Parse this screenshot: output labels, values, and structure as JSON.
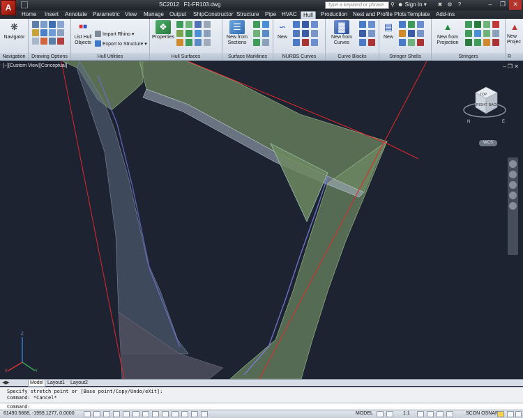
{
  "titlebar": {
    "app_name": "SC2012",
    "file_name": "F1-FR103.dwg",
    "search_placeholder": "Type a keyword or phrase",
    "sign_in": "Sign In"
  },
  "tabs": [
    {
      "label": "Home"
    },
    {
      "label": "Insert"
    },
    {
      "label": "Annotate"
    },
    {
      "label": "Parametric"
    },
    {
      "label": "View"
    },
    {
      "label": "Manage"
    },
    {
      "label": "Output"
    },
    {
      "label": "ShipConstructor"
    },
    {
      "label": "Structure"
    },
    {
      "label": "Pipe"
    },
    {
      "label": "HVAC"
    },
    {
      "label": "Hull"
    },
    {
      "label": "Production"
    },
    {
      "label": "Nest and Profile Plots"
    },
    {
      "label": "Template"
    },
    {
      "label": "Add-ins"
    }
  ],
  "active_tab": "Hull",
  "ribbon": {
    "navigation": {
      "title": "Navigation",
      "navigator": "Navigator"
    },
    "drawing_options": {
      "title": "Drawing Options"
    },
    "hull_utilities": {
      "title": "Hull Utilities",
      "list_hull_objects_1": "List Hull",
      "list_hull_objects_2": "Objects",
      "import_rhino": "Import Rhino",
      "export_to_structure": "Export to Structure"
    },
    "hull_surfaces": {
      "title": "Hull Surfaces",
      "properties": "Properties"
    },
    "surface_marklines": {
      "title": "Surface Marklines",
      "new_from_sections_1": "New from",
      "new_from_sections_2": "Sections"
    },
    "nurbs_curves": {
      "title": "NURBS Curves",
      "new": "New"
    },
    "curve_blocks": {
      "title": "Curve Blocks",
      "new_from_curves_1": "New from",
      "new_from_curves_2": "Curves"
    },
    "stringer_shells": {
      "title": "Stringer Shells",
      "new": "New"
    },
    "stringers": {
      "title": "Stringers",
      "new_from_projection_1": "New from",
      "new_from_projection_2": "Projection"
    },
    "overflow": {
      "title": "R",
      "label_1": "New",
      "label_2": "Projec"
    }
  },
  "viewport": {
    "view_label": "[−][Custom View][Conceptual]",
    "wcs": "WCS",
    "viewcube": {
      "top": "TOP",
      "left": "RIGHT",
      "right": "BACK"
    },
    "compass": {
      "n": "N",
      "e": "E"
    },
    "ucs": {
      "x": "X",
      "y": "Y",
      "z": "Z"
    }
  },
  "layout_tabs": [
    {
      "label": "Model"
    },
    {
      "label": "Layout1"
    },
    {
      "label": "Layout2"
    }
  ],
  "command": {
    "history_1": "Specify stretch point or [Base point/Copy/Undo/eXit]:",
    "history_2": "Command: *Cancel*",
    "prompt": "Command:"
  },
  "statusbar": {
    "coords": "61490.5868, -1959.1277, 0.0000",
    "model": "MODEL",
    "scale": "1:1",
    "scon_osnap": "SCON OSNAP"
  },
  "colors": {
    "titlebar": "#2a2e35",
    "viewport_bg": "#1d2331",
    "plate_fill": "#6f8a62",
    "red_line": "#e0282a"
  }
}
